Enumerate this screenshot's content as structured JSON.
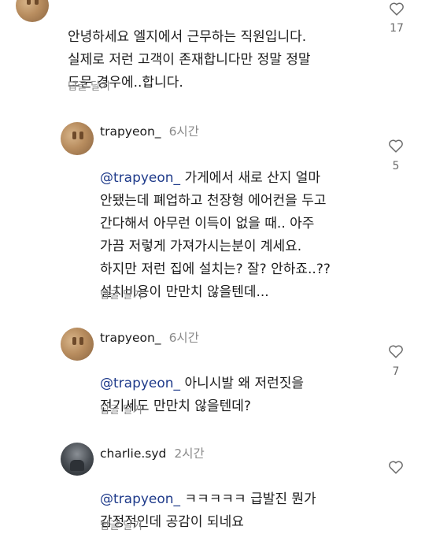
{
  "comments": [
    {
      "username": "",
      "time": "",
      "mention": "",
      "text": "안녕하세요 엘지에서 근무하는 직원입니다.\n실제로 저런 고객이 존재합니다만 정말 정말\n드문 경우에..합니다.",
      "reply_label": "답글 달기",
      "likes": "17"
    },
    {
      "username": "trapyeon_",
      "time": "6시간",
      "mention": "@trapyeon_",
      "text": " 가게에서 새로 산지 얼마\n안됐는데 폐업하고 천장형 에어컨을 두고\n간다해서 아무런 이득이 없을 때.. 아주\n가끔 저렇게 가져가시는분이 계세요.\n하지만 저런 집에 설치는? 잘? 안하죠..??\n설치비용이 만만치 않을텐데...",
      "reply_label": "답글 달기",
      "likes": "5"
    },
    {
      "username": "trapyeon_",
      "time": "6시간",
      "mention": "@trapyeon_",
      "text": " 아니시발 왜 저런짓을\n전기세도 만만치 않을텐데?",
      "reply_label": "답글 달기",
      "likes": "7"
    },
    {
      "username": "charlie.syd",
      "time": "2시간",
      "mention": "@trapyeon_",
      "text": " ㅋㅋㅋㅋㅋ 급발진 뭔가\n감정적인데 공감이 되네요",
      "reply_label": "답글 달기",
      "likes": ""
    }
  ],
  "icons": {
    "like": "heart-outline-icon"
  },
  "colors": {
    "mention": "#1e3a8a",
    "muted": "#8a8a8a",
    "text": "#1a1a1a"
  }
}
